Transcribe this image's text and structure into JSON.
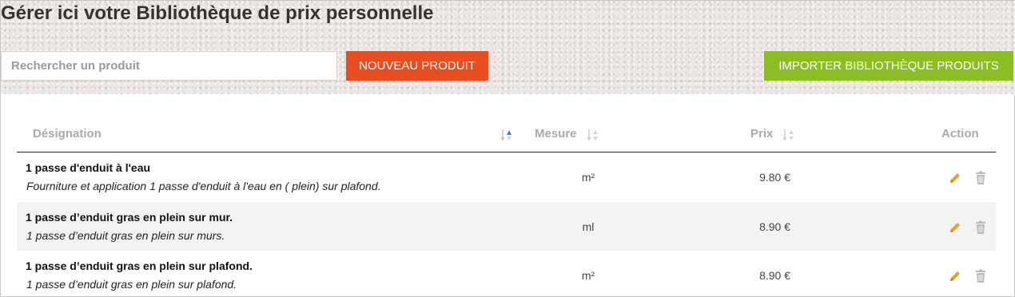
{
  "page": {
    "title": "Gérer ici votre Bibliothèque de prix personnelle"
  },
  "toolbar": {
    "search_placeholder": "Rechercher un produit",
    "search_value": "",
    "new_product_label": "NOUVEAU PRODUIT",
    "import_label": "IMPORTER BIBLIOTHÈQUE PRODUITS"
  },
  "colors": {
    "new_button": "#e84e22",
    "import_button": "#8cbd22",
    "edit_icon": "#f0a020",
    "trash_icon": "#bbbbbb",
    "sort_active": "#5a6ec8"
  },
  "table": {
    "headers": {
      "designation": "Désignation",
      "mesure": "Mesure",
      "prix": "Prix",
      "action": "Action"
    },
    "sort_icons": [
      "sort-designation-icon",
      "sort-mesure-icon",
      "sort-prix-icon"
    ],
    "rows": [
      {
        "name": "1 passe d'enduit à l'eau",
        "description": "Fourniture et application 1 passe d'enduit à l'eau en ( plein) sur plafond.",
        "mesure": "m²",
        "prix": "9.80 €"
      },
      {
        "name": "1 passe d’enduit gras en plein sur mur.",
        "description": "1 passe d’enduit gras en plein sur murs.",
        "mesure": "ml",
        "prix": "8.90 €"
      },
      {
        "name": "1 passe d’enduit gras en plein sur plafond.",
        "description": "1 passe d’enduit gras en plein sur plafond.",
        "mesure": "m²",
        "prix": "8.90 €"
      }
    ],
    "row_actions": [
      "pencil-icon",
      "trash-icon"
    ]
  }
}
